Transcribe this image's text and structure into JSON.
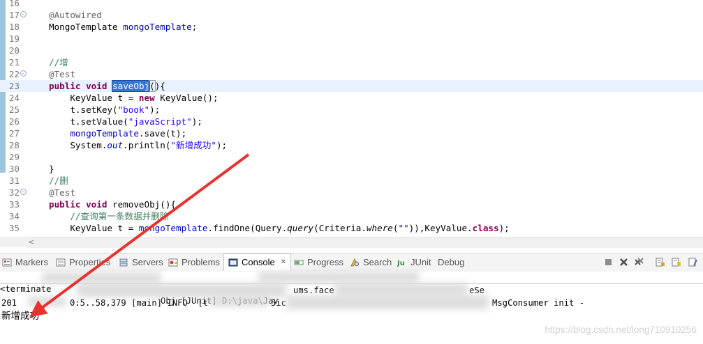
{
  "editor": {
    "lines": [
      {
        "n": "16",
        "segs": []
      },
      {
        "n": "17",
        "fold": "-",
        "segs": [
          [
            "an",
            "@Autowired"
          ]
        ]
      },
      {
        "n": "18",
        "segs": [
          [
            "",
            "MongoTemplate "
          ],
          [
            "fd",
            "mongoTemplate"
          ],
          [
            "",
            ";"
          ]
        ]
      },
      {
        "n": "19",
        "segs": []
      },
      {
        "n": "20",
        "segs": []
      },
      {
        "n": "21",
        "segs": [
          [
            "cm",
            "//增"
          ]
        ]
      },
      {
        "n": "22",
        "fold": "-",
        "segs": [
          [
            "an",
            "@Test"
          ]
        ]
      },
      {
        "n": "23",
        "current": true,
        "segs": [
          [
            "kw",
            "public"
          ],
          [
            "",
            " "
          ],
          [
            "kw",
            "void"
          ],
          [
            "",
            " "
          ],
          [
            "sel",
            "saveObj"
          ],
          [
            "caret-brk",
            "("
          ],
          [
            "",
            "){"
          ]
        ]
      },
      {
        "n": "24",
        "segs": [
          [
            "",
            "    KeyValue t = "
          ],
          [
            "kw",
            "new"
          ],
          [
            "",
            " KeyValue();"
          ]
        ]
      },
      {
        "n": "25",
        "segs": [
          [
            "",
            "    t.setKey("
          ],
          [
            "st",
            "\"book\""
          ],
          [
            "",
            ");"
          ]
        ]
      },
      {
        "n": "26",
        "segs": [
          [
            "",
            "    t.setValue("
          ],
          [
            "st",
            "\"javaScript\""
          ],
          [
            "",
            ");"
          ]
        ]
      },
      {
        "n": "27",
        "segs": [
          [
            "",
            "    "
          ],
          [
            "fd",
            "mongoTemplate"
          ],
          [
            "",
            ".save(t);"
          ]
        ]
      },
      {
        "n": "28",
        "segs": [
          [
            "",
            "    System."
          ],
          [
            "sf",
            "out"
          ],
          [
            "",
            ".println("
          ],
          [
            "st",
            "\"新增成功\""
          ],
          [
            "",
            ");"
          ]
        ]
      },
      {
        "n": "29",
        "segs": []
      },
      {
        "n": "30",
        "segs": [
          [
            "",
            "}"
          ]
        ]
      },
      {
        "n": "31",
        "segs": [
          [
            "cm",
            "//删"
          ]
        ]
      },
      {
        "n": "32",
        "fold": "-",
        "segs": [
          [
            "an",
            "@Test"
          ]
        ]
      },
      {
        "n": "33",
        "segs": [
          [
            "kw",
            "public"
          ],
          [
            "",
            " "
          ],
          [
            "kw",
            "void"
          ],
          [
            "",
            " removeObj(){"
          ]
        ]
      },
      {
        "n": "34",
        "segs": [
          [
            "",
            "    "
          ],
          [
            "cm",
            "//查询第一条数据并删除"
          ]
        ]
      },
      {
        "n": "35",
        "segs": [
          [
            "",
            "    KeyValue t = "
          ],
          [
            "fd",
            "mongoTemplate"
          ],
          [
            "",
            ".findOne(Query."
          ],
          [
            "it",
            "query"
          ],
          [
            "",
            "(Criteria."
          ],
          [
            "it",
            "where"
          ],
          [
            "",
            "("
          ],
          [
            "st",
            "\"\""
          ],
          [
            "",
            ")),KeyValue."
          ],
          [
            "kw",
            "class"
          ],
          [
            "",
            ");"
          ]
        ]
      }
    ]
  },
  "scroll": {
    "left_arrow": "<"
  },
  "views": {
    "tabs": [
      {
        "label": "Markers",
        "icon": "markers-icon"
      },
      {
        "label": "Properties",
        "icon": "properties-icon"
      },
      {
        "label": "Servers",
        "icon": "servers-icon"
      },
      {
        "label": "Problems",
        "icon": "problems-icon"
      },
      {
        "label": "Console",
        "icon": "console-icon",
        "active": true
      },
      {
        "label": "Progress",
        "icon": "progress-icon"
      },
      {
        "label": "Search",
        "icon": "search-icon"
      },
      {
        "label": "JUnit",
        "icon": "junit-icon"
      },
      {
        "label": "Debug",
        "icon": "debug-icon"
      }
    ],
    "close_glyph": "✕",
    "colors": {
      "active_border": "#b8cfe5",
      "bar_bg": "#f4f4f4"
    }
  },
  "console": {
    "header_prefix": "<terminate",
    "header_mid": "Obj [JUnit] D:\\java\\Jav",
    "line2_frag": "ums.face",
    "line2_frag2": "eSe",
    "line3_prefix": "201",
    "line3_mid": "0:5..58,379 [main] INFO  [t",
    "line3_mid2": "5ic",
    "line3_tail": "MsgConsumer init -",
    "result": "新增成功",
    "watermark": "https://blog.csdn.net/long710910256"
  },
  "annotation": {
    "arrow_color": "#e8322f"
  }
}
